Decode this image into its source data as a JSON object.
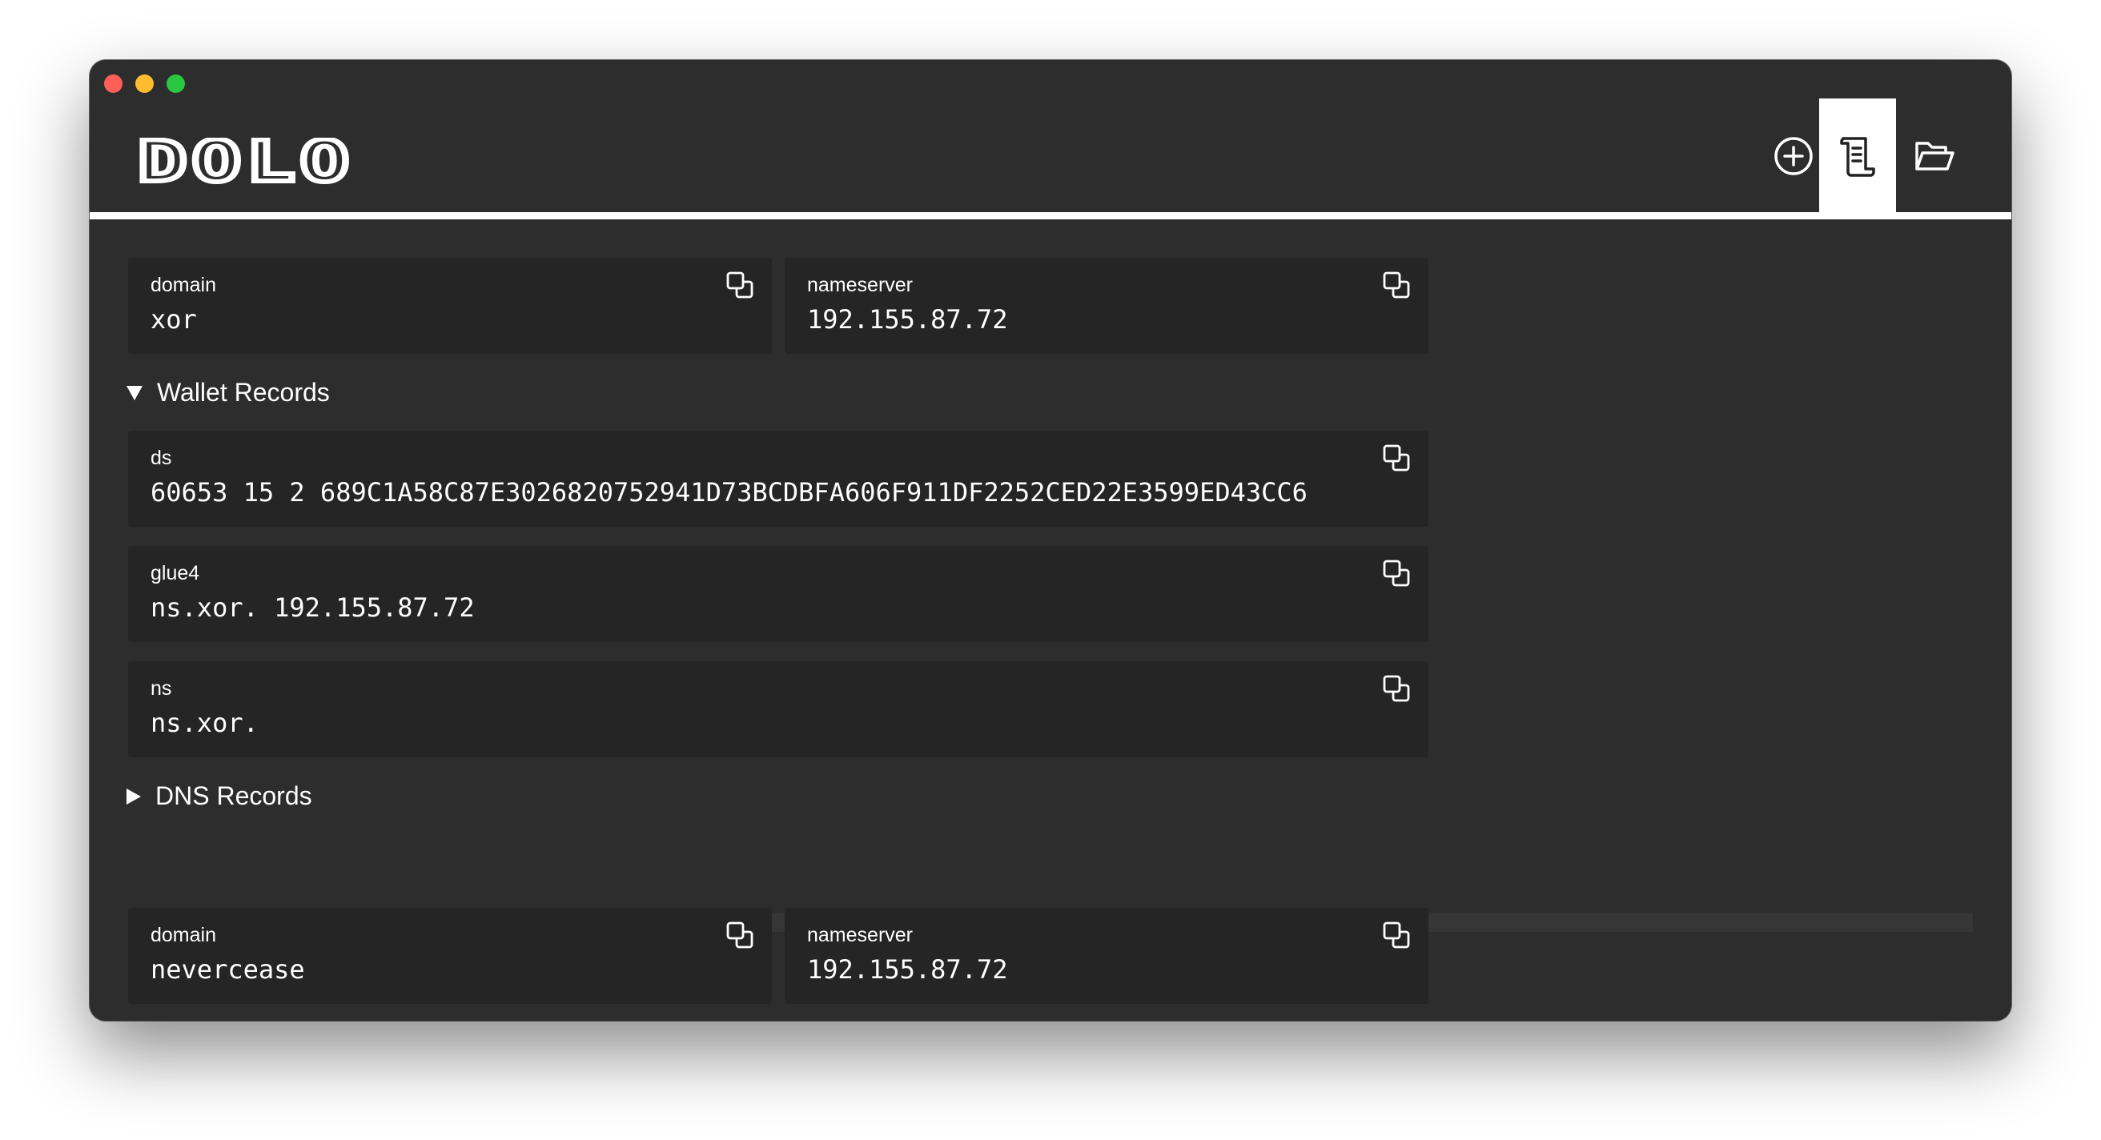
{
  "app": {
    "logo_text": "DOLO"
  },
  "header": {
    "buttons": [
      {
        "name": "add",
        "icon": "plus-circle-icon"
      },
      {
        "name": "records",
        "icon": "scroll-icon",
        "active": true
      },
      {
        "name": "open",
        "icon": "folder-open-icon"
      }
    ]
  },
  "entry1": {
    "domain": {
      "label": "domain",
      "value": "xor"
    },
    "nameserver": {
      "label": "nameserver",
      "value": "192.155.87.72"
    },
    "wallet_section": {
      "title": "Wallet Records",
      "expanded": true
    },
    "wallet_records": [
      {
        "label": "ds",
        "value": "60653 15 2 689C1A58C87E3026820752941D73BCDBFA606F911DF2252CED22E3599ED43CC6"
      },
      {
        "label": "glue4",
        "value": "ns.xor. 192.155.87.72"
      },
      {
        "label": "ns",
        "value": "ns.xor."
      }
    ],
    "dns_section": {
      "title": "DNS Records",
      "expanded": false
    }
  },
  "entry2": {
    "domain": {
      "label": "domain",
      "value": "nevercease"
    },
    "nameserver": {
      "label": "nameserver",
      "value": "192.155.87.72"
    }
  },
  "colors": {
    "window_bg": "#2d2d2d",
    "card_bg": "#252525",
    "accent": "#ffffff"
  }
}
